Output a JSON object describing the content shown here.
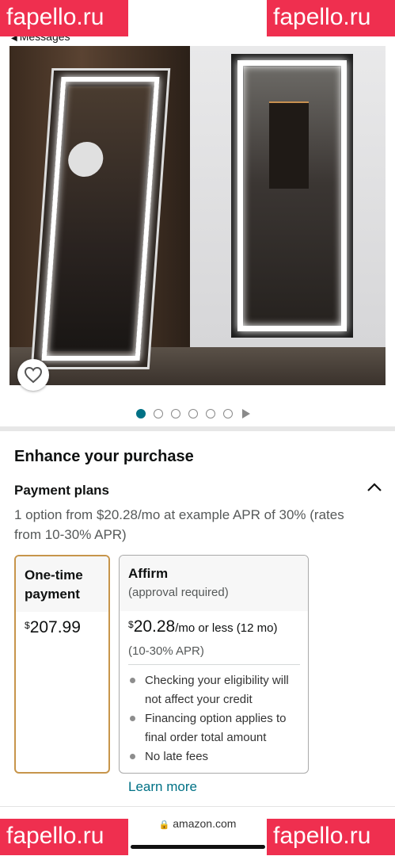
{
  "status": {
    "back_label": "Messages"
  },
  "watermarks": [
    "fapello.ru",
    "fapello.ru",
    "fapello.ru",
    "fapello.ru"
  ],
  "product": {
    "image": "lighted-full-length-mirror-photo",
    "wishlist_icon": "heart-outline-icon"
  },
  "carousel": {
    "total_dots": 6,
    "active_index": 0,
    "video_icon": "play-icon",
    "active_color": "#007185"
  },
  "section_title": "Enhance your purchase",
  "payment_plans": {
    "title": "Payment plans",
    "collapse_icon": "chevron-up-icon",
    "description": "1 option from $20.28/mo at example APR of 30% (rates from 10-30% APR)",
    "one_time": {
      "label": "One-time payment",
      "currency": "$",
      "price": "207.99",
      "selected": true,
      "border_color": "#c7954b"
    },
    "affirm": {
      "name": "Affirm",
      "subtitle": "(approval required)",
      "currency": "$",
      "amount": "20.28",
      "per_month": "/mo or less (12 mo)",
      "apr": "(10-30% APR)",
      "bullets": [
        "Checking your eligibility will not affect your credit",
        "Financing option applies to final order total amount",
        "No late fees"
      ]
    },
    "learn_more": "Learn more"
  },
  "browser": {
    "url": "amazon.com"
  }
}
